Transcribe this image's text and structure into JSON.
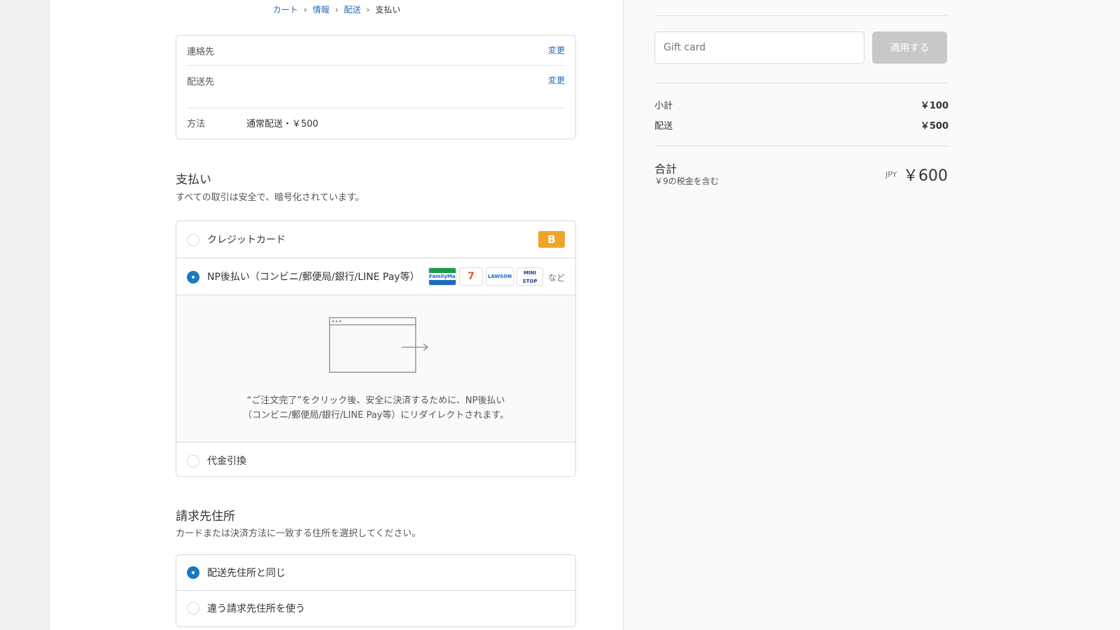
{
  "breadcrumb": {
    "items": [
      {
        "label": "カート"
      },
      {
        "label": "情報"
      },
      {
        "label": "配送"
      }
    ],
    "current": "支払い"
  },
  "review": {
    "contact_label": "連絡先",
    "contact_change": "変更",
    "ship_label": "配送先",
    "ship_change": "変更",
    "method_label": "方法",
    "method_value": "通常配送・￥500"
  },
  "payment": {
    "title": "支払い",
    "subtitle": "すべての取引は安全で、暗号化されています。",
    "options": [
      {
        "label": "クレジットカード",
        "selected": false
      },
      {
        "label": "NP後払い（コンビニ/郵便局/銀行/LINE Pay等）",
        "selected": true
      },
      {
        "label": "代金引換",
        "selected": false
      }
    ],
    "credit_badge": "B",
    "logos": [
      "FamilyMart",
      "7",
      "LAWSON",
      "MINI STOP"
    ],
    "logos_suffix": "など",
    "redirect_line1": "“ご注文完了”をクリック後、安全に決済するために、NP後払い",
    "redirect_line2": "（コンビニ/郵便局/銀行/LINE Pay等）にリダイレクトされます。"
  },
  "billing": {
    "title": "請求先住所",
    "subtitle": "カードまたは決済方法に一致する住所を選択してください。",
    "options": [
      {
        "label": "配送先住所と同じ",
        "selected": true
      },
      {
        "label": "違う請求先住所を使う",
        "selected": false
      }
    ]
  },
  "summary": {
    "gift_placeholder": "Gift card",
    "apply_label": "適用する",
    "subtotal_label": "小計",
    "subtotal_value": "￥100",
    "shipping_label": "配送",
    "shipping_value": "￥500",
    "total_label": "合計",
    "tax_note": "￥9の税金を含む",
    "currency": "JPY",
    "total_value": "￥600"
  },
  "colors": {
    "accent": "#1979c3",
    "link": "#1f69c2",
    "badge": "#f0a52a"
  }
}
